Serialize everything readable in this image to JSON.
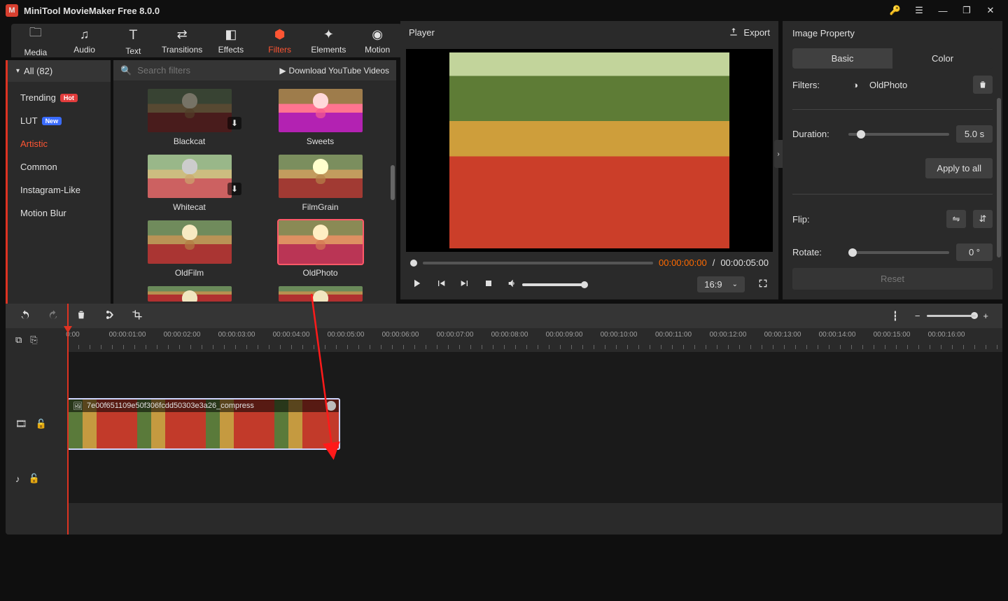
{
  "app_title": "MiniTool MovieMaker Free 8.0.0",
  "top_tabs": {
    "media": "Media",
    "audio": "Audio",
    "text": "Text",
    "transitions": "Transitions",
    "effects": "Effects",
    "filters": "Filters",
    "elements": "Elements",
    "motion": "Motion",
    "active": "filters"
  },
  "sidebar": {
    "all_label": "All (82)",
    "categories": [
      {
        "label": "Trending",
        "badge": "Hot"
      },
      {
        "label": "LUT",
        "badge": "New"
      },
      {
        "label": "Artistic",
        "active": true
      },
      {
        "label": "Common"
      },
      {
        "label": "Instagram-Like"
      },
      {
        "label": "Motion Blur"
      }
    ]
  },
  "search": {
    "placeholder": "Search filters",
    "download_label": "Download YouTube Videos"
  },
  "filters_grid": [
    {
      "name": "Blackcat",
      "cls": "blackcat",
      "dl": true
    },
    {
      "name": "Sweets",
      "cls": "sweets"
    },
    {
      "name": "Whitecat",
      "cls": "whitecat",
      "dl": true
    },
    {
      "name": "FilmGrain",
      "cls": "filmgrain"
    },
    {
      "name": "OldFilm",
      "cls": "oldfilm"
    },
    {
      "name": "OldPhoto",
      "cls": "oldphoto",
      "selected": true
    }
  ],
  "player": {
    "title": "Player",
    "export_label": "Export",
    "current_time": "00:00:00:00",
    "total_time": "00:00:05:00",
    "aspect": "16:9"
  },
  "property": {
    "title": "Image Property",
    "tab_basic": "Basic",
    "tab_color": "Color",
    "filters_label": "Filters:",
    "filter_value": "OldPhoto",
    "duration_label": "Duration:",
    "duration_value": "5.0 s",
    "apply_label": "Apply to all",
    "flip_label": "Flip:",
    "rotate_label": "Rotate:",
    "rotate_value": "0 °",
    "reset_label": "Reset"
  },
  "timeline": {
    "ticks": [
      "0:00",
      "00:00:01:00",
      "00:00:02:00",
      "00:00:03:00",
      "00:00:04:00",
      "00:00:05:00",
      "00:00:06:00",
      "00:00:07:00",
      "00:00:08:00",
      "00:00:09:00",
      "00:00:10:00",
      "00:00:11:00",
      "00:00:12:00",
      "00:00:13:00",
      "00:00:14:00",
      "00:00:15:00",
      "00:00:16:00"
    ],
    "clip_name": "7e00f651109e50f306fcdd50303e3a26_compress"
  }
}
